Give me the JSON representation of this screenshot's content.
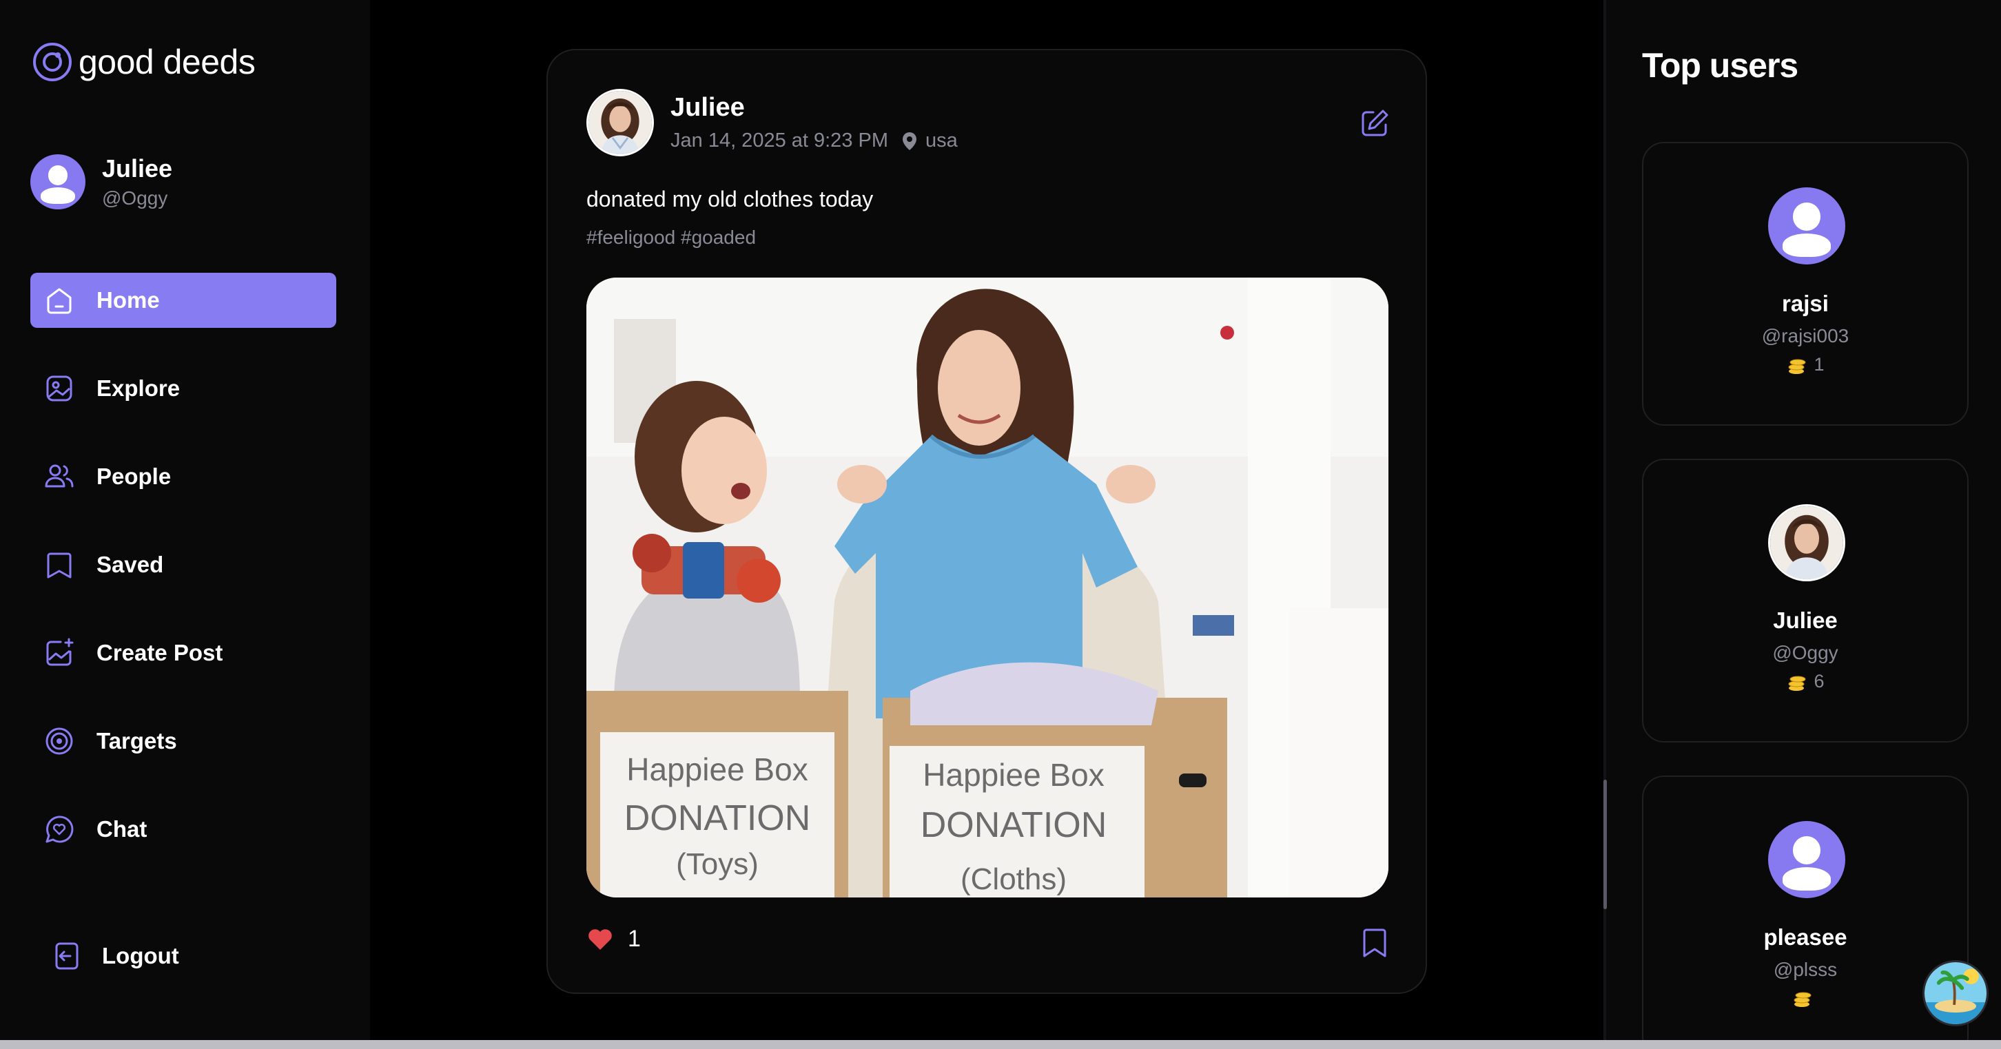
{
  "brand": {
    "name": "good deeds"
  },
  "current_user": {
    "name": "Juliee",
    "handle": "@Oggy"
  },
  "nav": {
    "items": [
      {
        "label": "Home",
        "icon": "home-icon",
        "active": true
      },
      {
        "label": "Explore",
        "icon": "explore-icon",
        "active": false
      },
      {
        "label": "People",
        "icon": "people-icon",
        "active": false
      },
      {
        "label": "Saved",
        "icon": "bookmark-icon",
        "active": false
      },
      {
        "label": "Create Post",
        "icon": "create-post-icon",
        "active": false
      },
      {
        "label": "Targets",
        "icon": "target-icon",
        "active": false
      },
      {
        "label": "Chat",
        "icon": "chat-icon",
        "active": false
      }
    ],
    "logout_label": "Logout"
  },
  "post": {
    "author": "Juliee",
    "timestamp": "Jan 14, 2025 at 9:23 PM",
    "location": "usa",
    "caption": "donated my old clothes today",
    "tags": "#feeligood #goaded",
    "image_labels": {
      "box_left_title": "Happiee Box",
      "box_left_type": "DONATION",
      "box_left_sub": "(Toys)",
      "box_right_title": "Happiee Box",
      "box_right_type": "DONATION",
      "box_right_sub": "(Cloths)"
    },
    "likes": "1"
  },
  "top_users": {
    "title": "Top users",
    "users": [
      {
        "name": "rajsi",
        "handle": "@rajsi003",
        "score": "1",
        "avatar": "default"
      },
      {
        "name": "Juliee",
        "handle": "@Oggy",
        "score": "6",
        "avatar": "photo"
      },
      {
        "name": "pleasee",
        "handle": "@plsss",
        "score": "",
        "avatar": "default"
      }
    ]
  },
  "colors": {
    "accent": "#877cf2",
    "background": "#000000",
    "panel": "#09090a",
    "muted_text": "#8a8a96",
    "like_red": "#e5484d",
    "coin_gold": "#f4c430"
  }
}
